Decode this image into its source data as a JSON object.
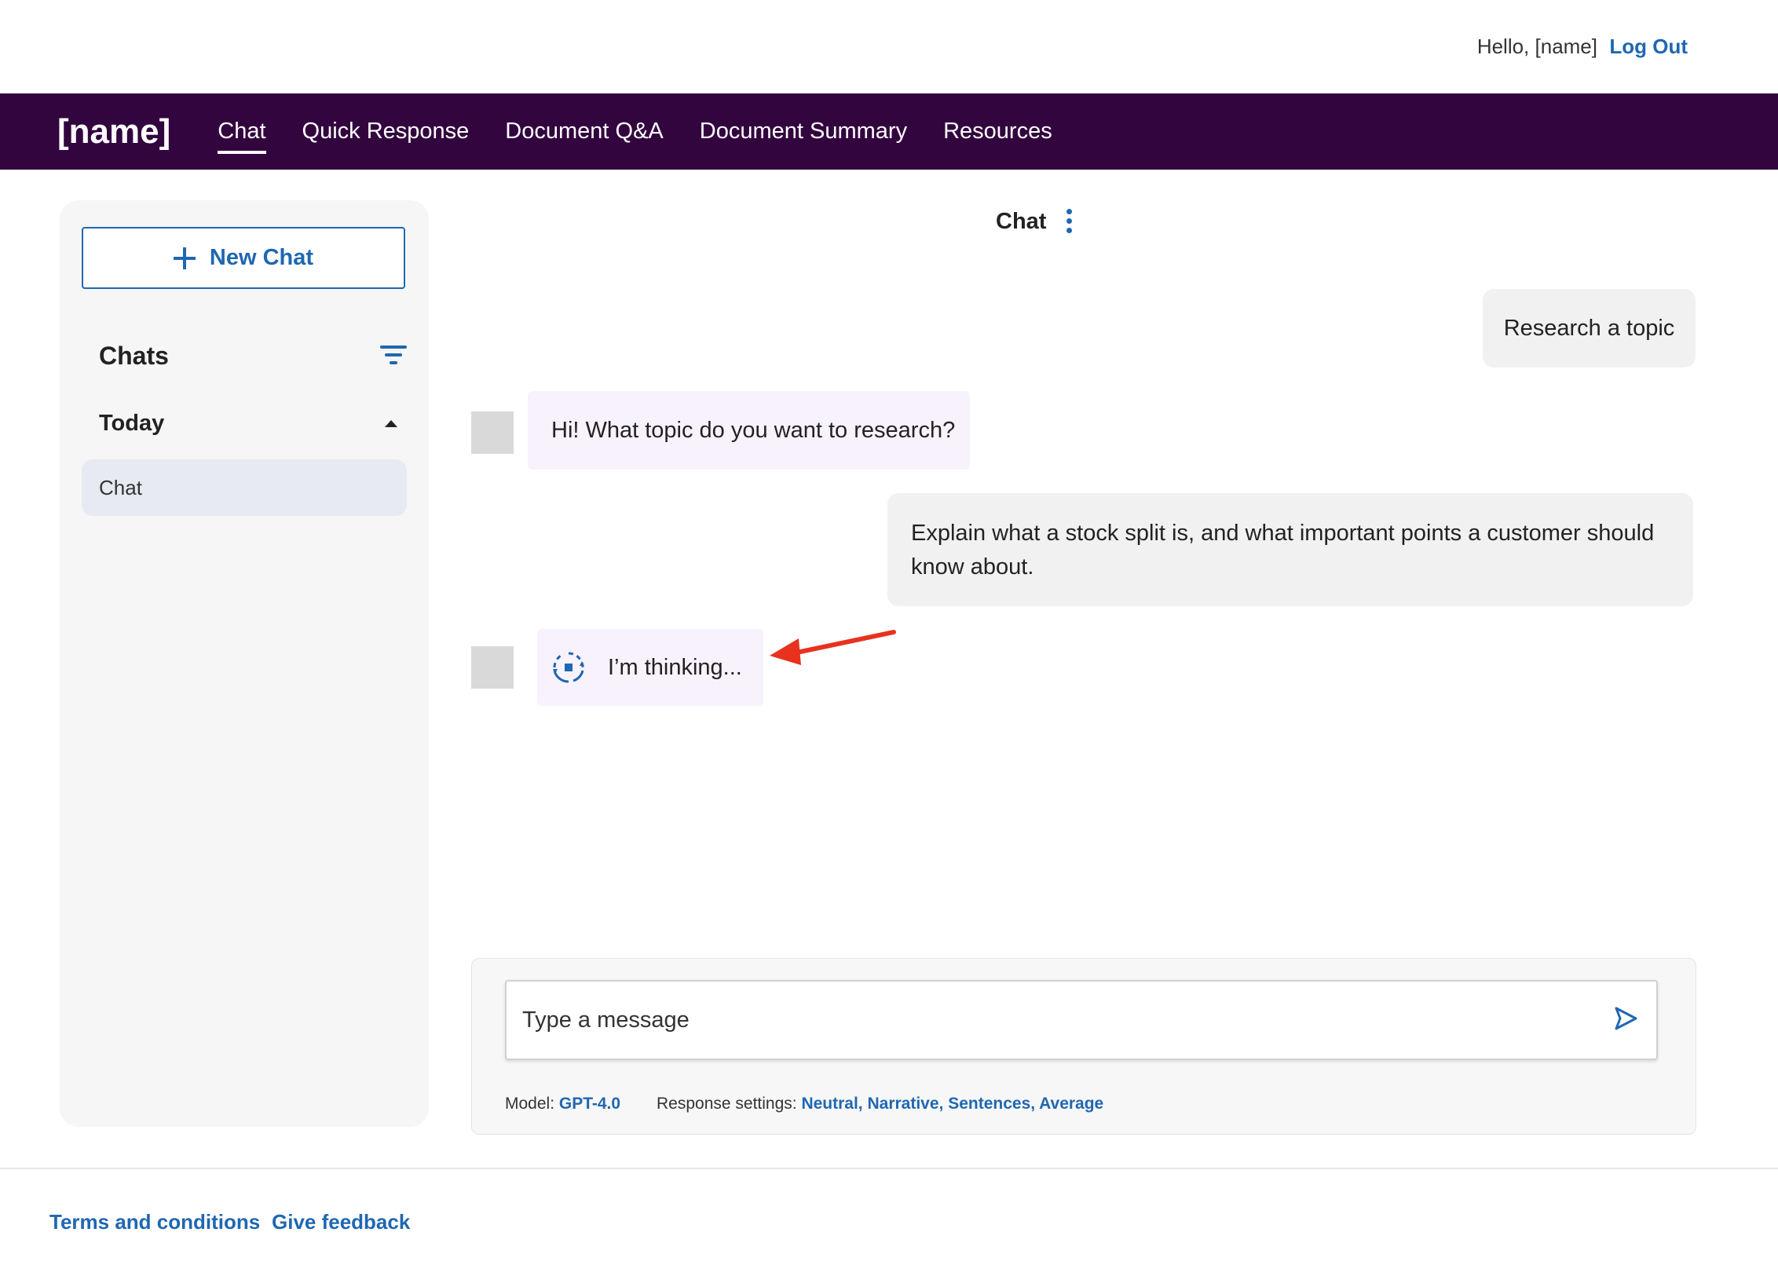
{
  "userbar": {
    "greeting": "Hello, [name]",
    "logout_label": "Log Out"
  },
  "nav": {
    "brand": "[name]",
    "items": [
      {
        "label": "Chat",
        "active": true
      },
      {
        "label": "Quick Response"
      },
      {
        "label": "Document Q&A"
      },
      {
        "label": "Document Summary"
      },
      {
        "label": "Resources"
      }
    ]
  },
  "sidebar": {
    "new_chat_label": "New Chat",
    "chats_heading": "Chats",
    "groups": [
      {
        "label": "Today",
        "items": [
          {
            "label": "Chat",
            "selected": true
          }
        ]
      }
    ]
  },
  "chat": {
    "title": "Chat",
    "messages": [
      {
        "role": "user",
        "text": "Research a topic"
      },
      {
        "role": "assistant",
        "text": "Hi! What topic do you want to research?"
      },
      {
        "role": "user",
        "text": "Explain what a stock split is, and what important points a customer should know about."
      },
      {
        "role": "assistant",
        "text": "I’m thinking...",
        "loading": true
      }
    ]
  },
  "composer": {
    "placeholder": "Type a message",
    "model_label": "Model:",
    "model_value": "GPT-4.0",
    "settings_label": "Response settings:",
    "settings_value": "Neutral, Narrative, Sentences, Average"
  },
  "footer": {
    "terms_label": "Terms and conditions",
    "feedback_label": "Give feedback"
  },
  "colors": {
    "brand_nav": "#33053f",
    "accent": "#1f67b1",
    "annotation_arrow": "#e8321e"
  },
  "icons": [
    "plus-icon",
    "filter-icon",
    "caret-up-icon",
    "kebab-icon",
    "spinner-icon",
    "send-icon",
    "arrow-annotation"
  ]
}
